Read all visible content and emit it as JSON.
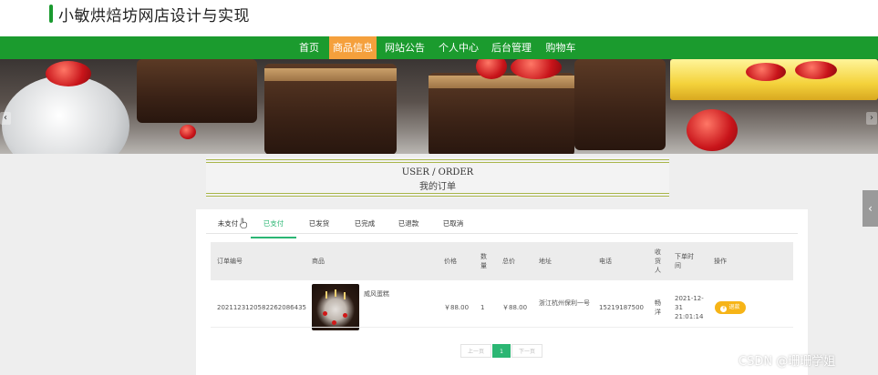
{
  "site": {
    "title": "小敏烘焙坊网店设计与实现"
  },
  "nav": {
    "items": [
      {
        "label": "首页",
        "active": false
      },
      {
        "label": "商品信息",
        "active": true
      },
      {
        "label": "网站公告",
        "active": false
      },
      {
        "label": "个人中心",
        "active": false
      },
      {
        "label": "后台管理",
        "active": false
      },
      {
        "label": "购物车",
        "active": false
      }
    ]
  },
  "banner": {
    "left_arrow_icon": "chevron-left-icon",
    "right_arrow_icon": "chevron-right-icon"
  },
  "section_header": {
    "en": "USER / ORDER",
    "cn": "我的订单"
  },
  "side_tab": {
    "icon": "chevron-left-icon"
  },
  "order_tabs": {
    "items": [
      {
        "label": "未支付",
        "active": false
      },
      {
        "label": "已支付",
        "active": true
      },
      {
        "label": "已发货",
        "active": false
      },
      {
        "label": "已完成",
        "active": false
      },
      {
        "label": "已退款",
        "active": false
      },
      {
        "label": "已取消",
        "active": false
      }
    ]
  },
  "table": {
    "headers": {
      "order_no": "订单编号",
      "product": "商品",
      "price": "价格",
      "quantity": "数量",
      "total": "总价",
      "address": "地址",
      "phone": "电话",
      "receiver": "收货人",
      "order_time": "下单时间",
      "actions": "操作"
    },
    "rows": [
      {
        "order_no": "20211231205822620864​35",
        "product_name": "威风蛋糕",
        "price": "￥88.00",
        "quantity": "1",
        "total": "￥88.00",
        "address": "浙江杭州保利一号",
        "phone": "15219187500",
        "receiver": "畅洋",
        "order_time": "2021-12-31 21:01:14",
        "action_label": "退款"
      }
    ]
  },
  "pagination": {
    "prev": "上一页",
    "current": "1",
    "next": "下一页"
  },
  "watermark": "CSDN @珊珊学姐",
  "colors": {
    "nav_green": "#1b9b2e",
    "active_orange": "#f5a03c",
    "tab_green": "#2bb673",
    "refund_yellow": "#f6b417"
  }
}
